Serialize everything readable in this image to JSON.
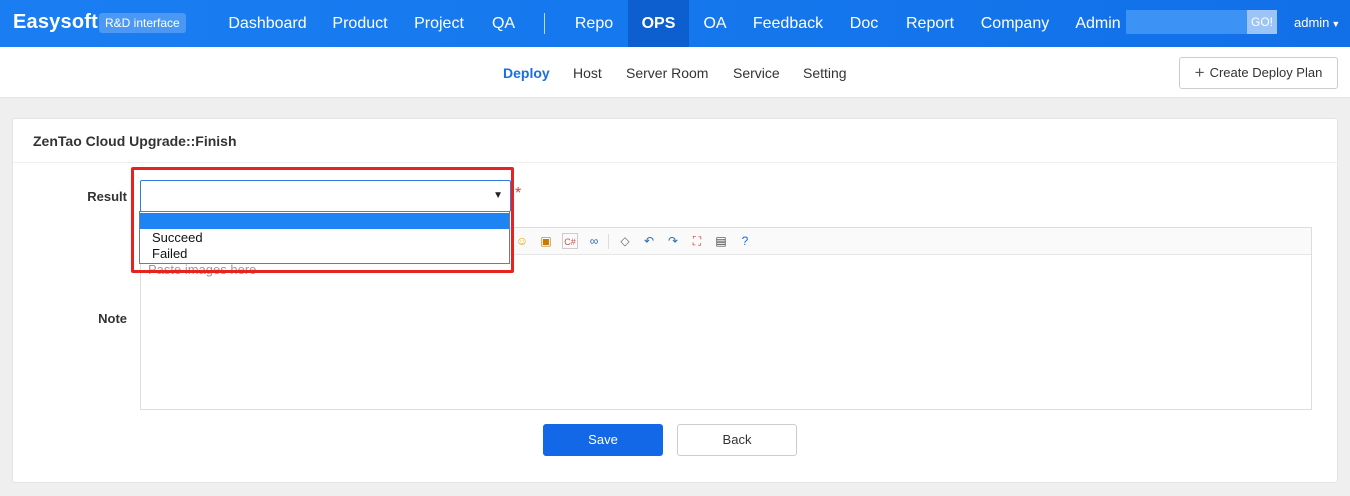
{
  "brand": {
    "name": "Easysoft",
    "badge": "R&D interface"
  },
  "nav": {
    "items": [
      "Dashboard",
      "Product",
      "Project",
      "QA",
      "Repo",
      "OPS",
      "OA",
      "Feedback",
      "Doc",
      "Report",
      "Company",
      "Admin"
    ],
    "active": "OPS",
    "search_placeholder": "",
    "go_label": "GO!",
    "user": "admin"
  },
  "subnav": {
    "items": [
      "Deploy",
      "Host",
      "Server Room",
      "Service",
      "Setting"
    ],
    "active": "Deploy",
    "create_label": "Create Deploy Plan"
  },
  "form": {
    "title": "ZenTao Cloud Upgrade::Finish",
    "result_label": "Result",
    "result_value": "",
    "result_options": [
      "",
      "Succeed",
      "Failed"
    ],
    "note_label": "Note",
    "note_placeholder": "Paste images here",
    "required_mark": "*",
    "save_label": "Save",
    "back_label": "Back"
  },
  "colors": {
    "topbar": "#1a7ef2",
    "active_nav": "#0d5fcf",
    "primary": "#1268e6",
    "annotation": "#e8231f"
  },
  "editor_toolbar_icons": [
    "emoticon-icon",
    "image-icon",
    "code-icon",
    "link-icon",
    "eraser-icon",
    "undo-icon",
    "redo-icon",
    "fullscreen-icon",
    "template-icon",
    "help-icon"
  ]
}
